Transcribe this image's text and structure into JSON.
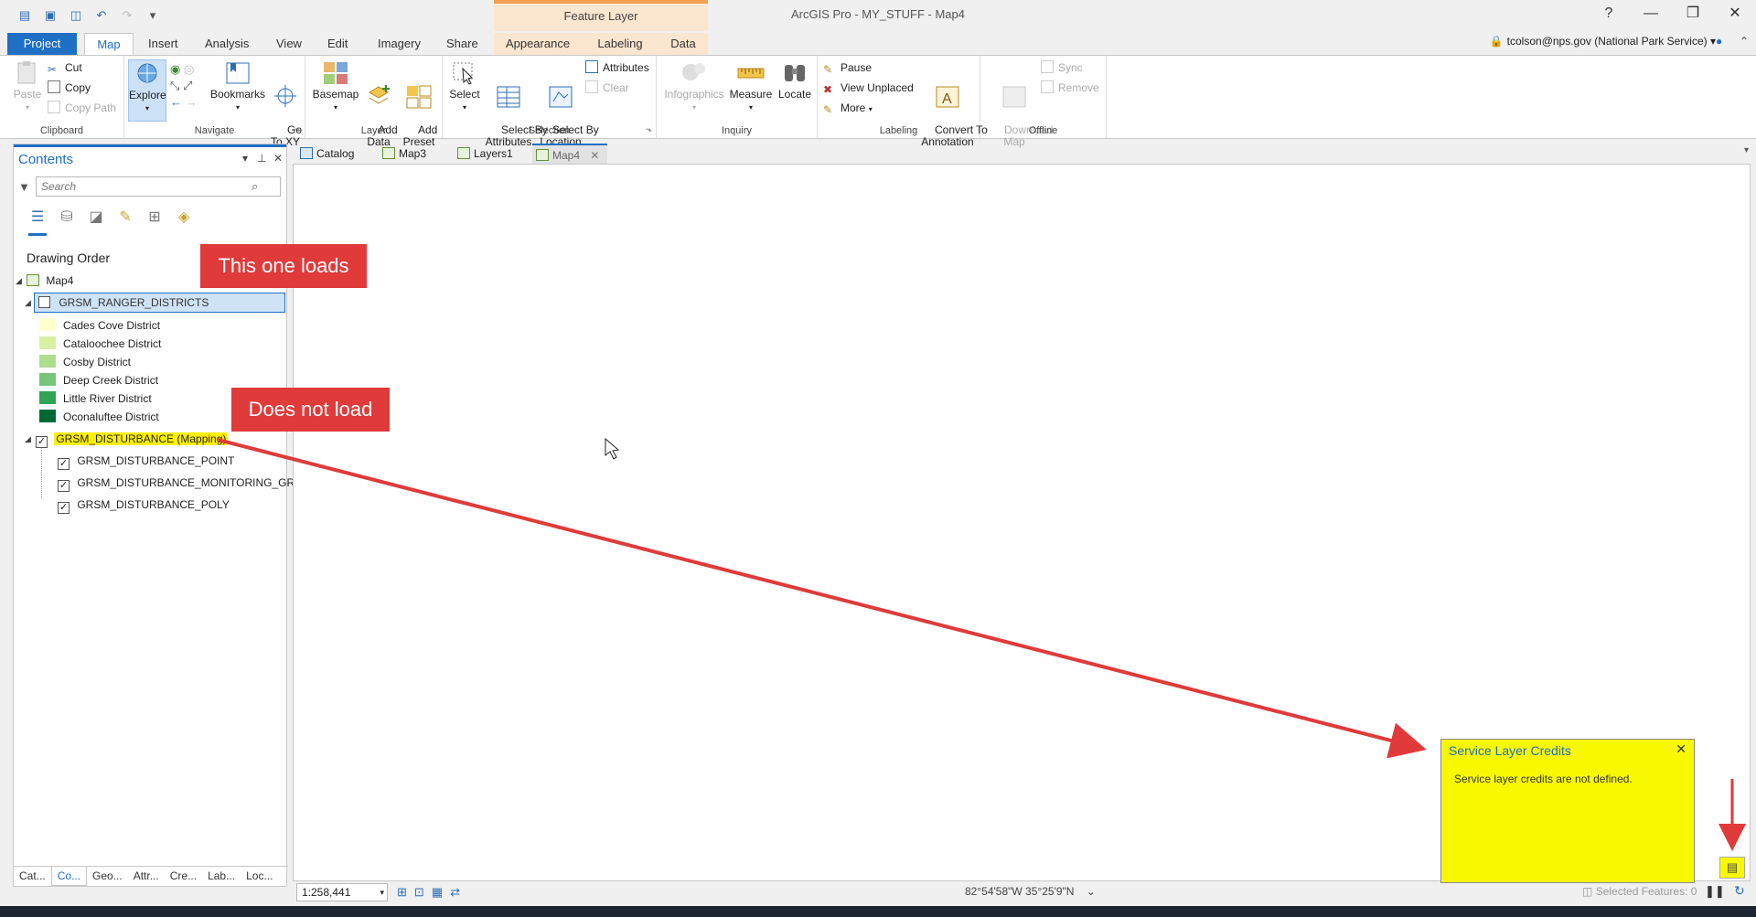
{
  "app": {
    "title": "ArcGIS Pro - MY_STUFF - Map4",
    "context_tab_header": "Feature Layer",
    "window_buttons": [
      "?",
      "—",
      "❐",
      "✕"
    ]
  },
  "ribbon_tabs": {
    "project": "Project",
    "map": "Map",
    "insert": "Insert",
    "analysis": "Analysis",
    "view": "View",
    "edit": "Edit",
    "imagery": "Imagery",
    "share": "Share",
    "appearance": "Appearance",
    "labeling": "Labeling",
    "data": "Data"
  },
  "user": {
    "account": "tcolson@nps.gov (National Park Service)"
  },
  "ribbon": {
    "clipboard": {
      "label": "Clipboard",
      "paste": "Paste",
      "cut": "Cut",
      "copy": "Copy",
      "copy_path": "Copy Path"
    },
    "navigate": {
      "label": "Navigate",
      "explore": "Explore",
      "bookmarks": "Bookmarks",
      "go_to_xy": "Go\nTo XY"
    },
    "layer": {
      "label": "Layer",
      "basemap": "Basemap",
      "add_data": "Add\nData",
      "add_preset": "Add\nPreset"
    },
    "selection": {
      "label": "Selection",
      "select": "Select",
      "select_by_attributes": "Select By\nAttributes",
      "select_by_location": "Select By\nLocation",
      "attributes": "Attributes",
      "clear": "Clear"
    },
    "inquiry": {
      "label": "Inquiry",
      "infographics": "Infographics",
      "measure": "Measure",
      "locate": "Locate"
    },
    "labeling": {
      "label": "Labeling",
      "pause": "Pause",
      "view_unplaced": "View Unplaced",
      "more": "More",
      "convert": "Convert To\nAnnotation"
    },
    "offline": {
      "label": "Offline",
      "download_map": "Download\nMap",
      "sync": "Sync",
      "remove": "Remove"
    }
  },
  "contents": {
    "title": "Contents",
    "search_placeholder": "Search",
    "drawing_order": "Drawing Order",
    "map_name": "Map4",
    "layer1": {
      "name": "GRSM_RANGER_DISTRICTS",
      "classes": [
        {
          "label": "Cades Cove District",
          "color": "#ffffcc"
        },
        {
          "label": "Cataloochee District",
          "color": "#d9f0a3"
        },
        {
          "label": "Cosby District",
          "color": "#addd8e"
        },
        {
          "label": "Deep Creek District",
          "color": "#78c679"
        },
        {
          "label": "Little River District",
          "color": "#31a354"
        },
        {
          "label": "Oconaluftee District",
          "color": "#006837"
        }
      ]
    },
    "layer2": {
      "name": "GRSM_DISTURBANCE (Mapping)",
      "sublayers": [
        "GRSM_DISTURBANCE_POINT",
        "GRSM_DISTURBANCE_MONITORING_GRID",
        "GRSM_DISTURBANCE_POLY"
      ]
    },
    "bottom_tabs": [
      "Cat...",
      "Co...",
      "Geo...",
      "Attr...",
      "Cre...",
      "Lab...",
      "Loc..."
    ]
  },
  "doc_tabs": [
    "Catalog",
    "Map3",
    "Layers1",
    "Map4"
  ],
  "status": {
    "scale": "1:258,441",
    "coordinates": "82°54'58\"W 35°25'9\"N",
    "selected_features": "Selected Features: 0"
  },
  "annotations": {
    "loads": "This one loads",
    "not_load": "Does not load"
  },
  "credits_popup": {
    "title": "Service Layer Credits",
    "body": "Service layer credits are not defined."
  },
  "colors": {
    "accent": "#1f6fc5",
    "callout": "#e03a3a",
    "highlight": "#fff000"
  }
}
